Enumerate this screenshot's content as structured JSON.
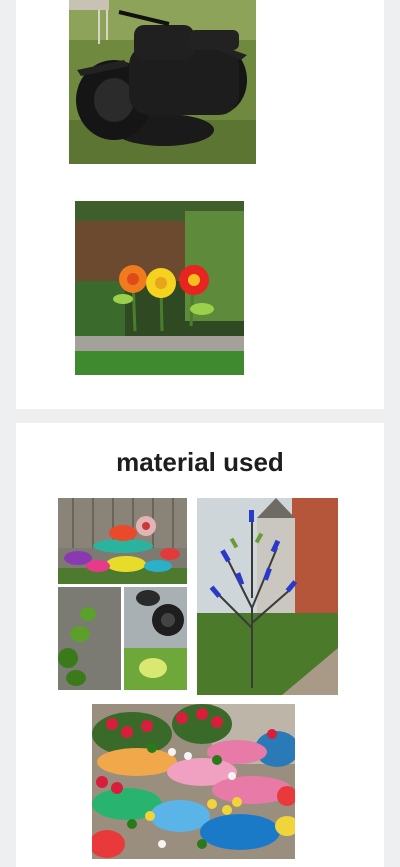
{
  "card1": {
    "images": [
      {
        "name": "tire-motorcycle-image",
        "alt": "tire-motorcycle-image"
      },
      {
        "name": "hubcap-flowers-image",
        "alt": "hubcap-flowers-image"
      }
    ]
  },
  "card2": {
    "heading": "material used",
    "images": [
      {
        "name": "tire-planters-collage-image",
        "alt": "tire-planters-collage-image"
      },
      {
        "name": "bottle-tree-image",
        "alt": "bottle-tree-image"
      },
      {
        "name": "stacked-tire-planters-image",
        "alt": "stacked-tire-planters-image"
      }
    ]
  },
  "colors": {
    "page_background": "#eeeff0",
    "card_background": "#ffffff",
    "heading_text": "#1e1e1e"
  }
}
